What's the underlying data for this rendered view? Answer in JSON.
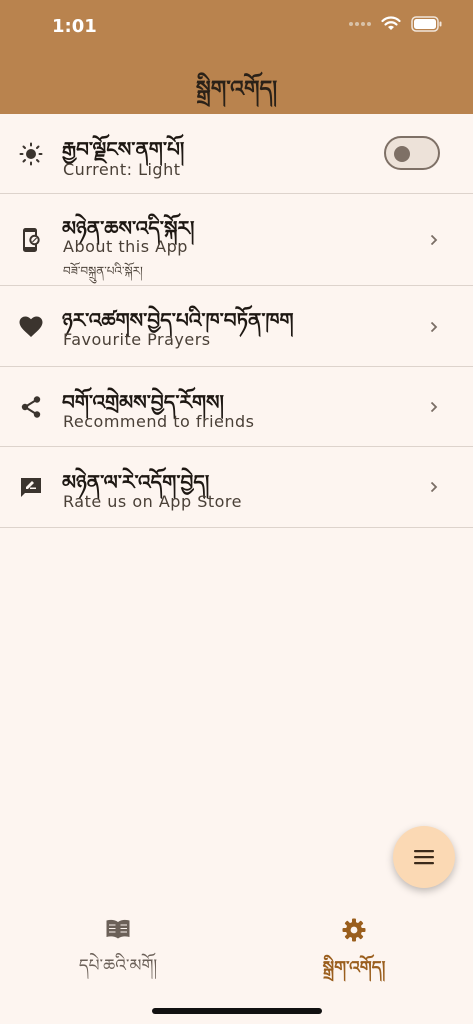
{
  "status_bar": {
    "time": "1:01"
  },
  "header": {
    "title": "སྒྲིག་འགོད།"
  },
  "settings": [
    {
      "title": "རྒྱབ་ལྗོངས་ནག་པོ།",
      "subtitle": "Current: Light",
      "icon": "brightness-icon",
      "control": "toggle",
      "toggle_on": false
    },
    {
      "title": "མཉེན་ཆས་འདི་སྐོར།",
      "subtitle": "About this App",
      "subtitle2": "བཟོ་བསྐྲུན་པའི་སྐོར།",
      "icon": "app-info-icon",
      "control": "chevron"
    },
    {
      "title": "ཉར་འཚགས་བྱེད་པའི་ཁ་བཏོན་ཁག",
      "subtitle": "Favourite Prayers",
      "icon": "heart-icon",
      "control": "chevron"
    },
    {
      "title": "བགོ་འགྲེམས་བྱེད་རོགས།",
      "subtitle": "Recommend to friends",
      "icon": "share-icon",
      "control": "chevron"
    },
    {
      "title": "མཉེན་ལ་རེ་འདོག་བྱེད།",
      "subtitle": "Rate us on App Store",
      "icon": "rate-review-icon",
      "control": "chevron"
    }
  ],
  "fab": {
    "icon": "menu-icon"
  },
  "bottom_nav": {
    "items": [
      {
        "label": "དཔེ་ཆའི་མགོ།",
        "icon": "book-icon",
        "active": false
      },
      {
        "label": "སྒྲིག་འགོད།",
        "icon": "gear-icon",
        "active": true
      }
    ]
  },
  "colors": {
    "header": "#b9834e",
    "background": "#fdf5f0",
    "active_nav": "#9a5e1d",
    "inactive_nav": "#6b6058",
    "fab": "#fbd9b4"
  }
}
